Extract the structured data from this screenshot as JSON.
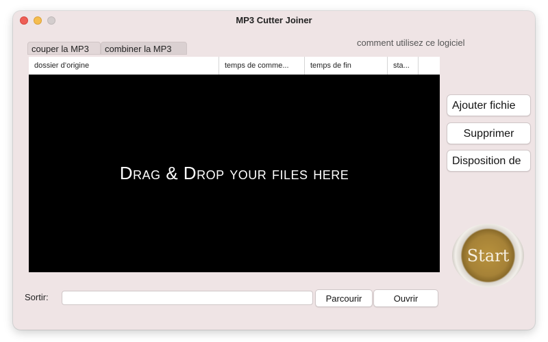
{
  "window": {
    "title": "MP3 Cutter Joiner"
  },
  "help_link": "comment utilisez ce logiciel",
  "tabs": [
    {
      "label": "couper la MP3"
    },
    {
      "label": "combiner la MP3"
    }
  ],
  "table": {
    "columns": [
      "dossier d’origine",
      "temps de comme...",
      "temps de fin",
      "sta...",
      ""
    ]
  },
  "drop_zone": {
    "text": "Drag & Drop your files here"
  },
  "side_buttons": {
    "add": "Ajouter fichie",
    "delete": "Supprimer",
    "layout": "Disposition de"
  },
  "start_button": {
    "label": "Start"
  },
  "output": {
    "label": "Sortir:",
    "value": "",
    "browse": "Parcourir",
    "open": "Ouvrir"
  }
}
